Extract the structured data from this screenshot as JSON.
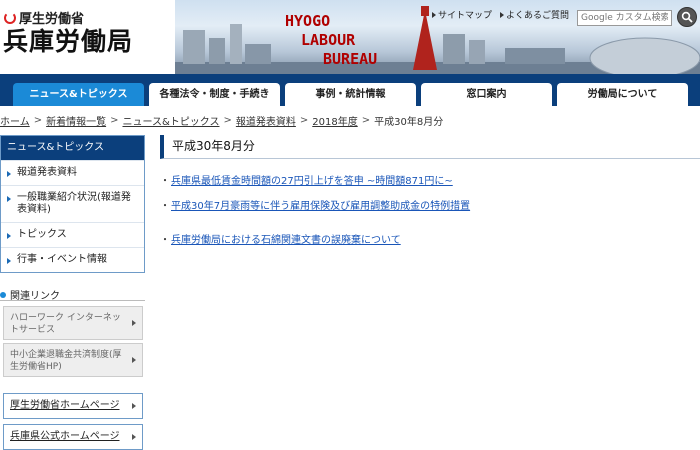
{
  "header": {
    "ministry": "厚生労働省",
    "bureau": "兵庫労働局",
    "banner_words": [
      "HYOGO",
      "LABOUR",
      "BUREAU"
    ],
    "util_links": [
      "サイトマップ",
      "よくあるご質問"
    ],
    "search_placeholder": "Google カスタム検索"
  },
  "nav": {
    "tabs": [
      "ニュース&トピックス",
      "各種法令・制度・手続き",
      "事例・統計情報",
      "窓口案内",
      "労働局について"
    ],
    "active_index": 0
  },
  "breadcrumb": [
    "ホーム",
    "新着情報一覧",
    "ニュース&トピックス",
    "報道発表資料",
    "2018年度",
    "平成30年8月分"
  ],
  "sidebar": {
    "header": "ニュース&トピックス",
    "items": [
      "報道発表資料",
      "一般職業紹介状況(報道発表資料)",
      "トピックス",
      "行事・イベント情報"
    ],
    "related_title": "関連リンク",
    "related_cards": [
      "ハローワーク インターネットサービス",
      "中小企業退職金共済制度(厚生労働省HP)"
    ],
    "external_links": [
      "厚生労働省ホームページ",
      "兵庫県公式ホームページ"
    ]
  },
  "main": {
    "title": "平成30年8月分",
    "news": [
      "兵庫県最低賃金時間額の27円引上げを答申 ~時間額871円に~",
      "平成30年7月豪雨等に伴う雇用保険及び雇用調整助成金の特例措置",
      "兵庫労働局における石綿関連文書の誤廃棄について"
    ]
  },
  "colors": {
    "navy": "#0b3f7c",
    "accent_blue": "#1b8ad7",
    "banner_red": "#b00000",
    "link_blue": "#1a56b8"
  }
}
